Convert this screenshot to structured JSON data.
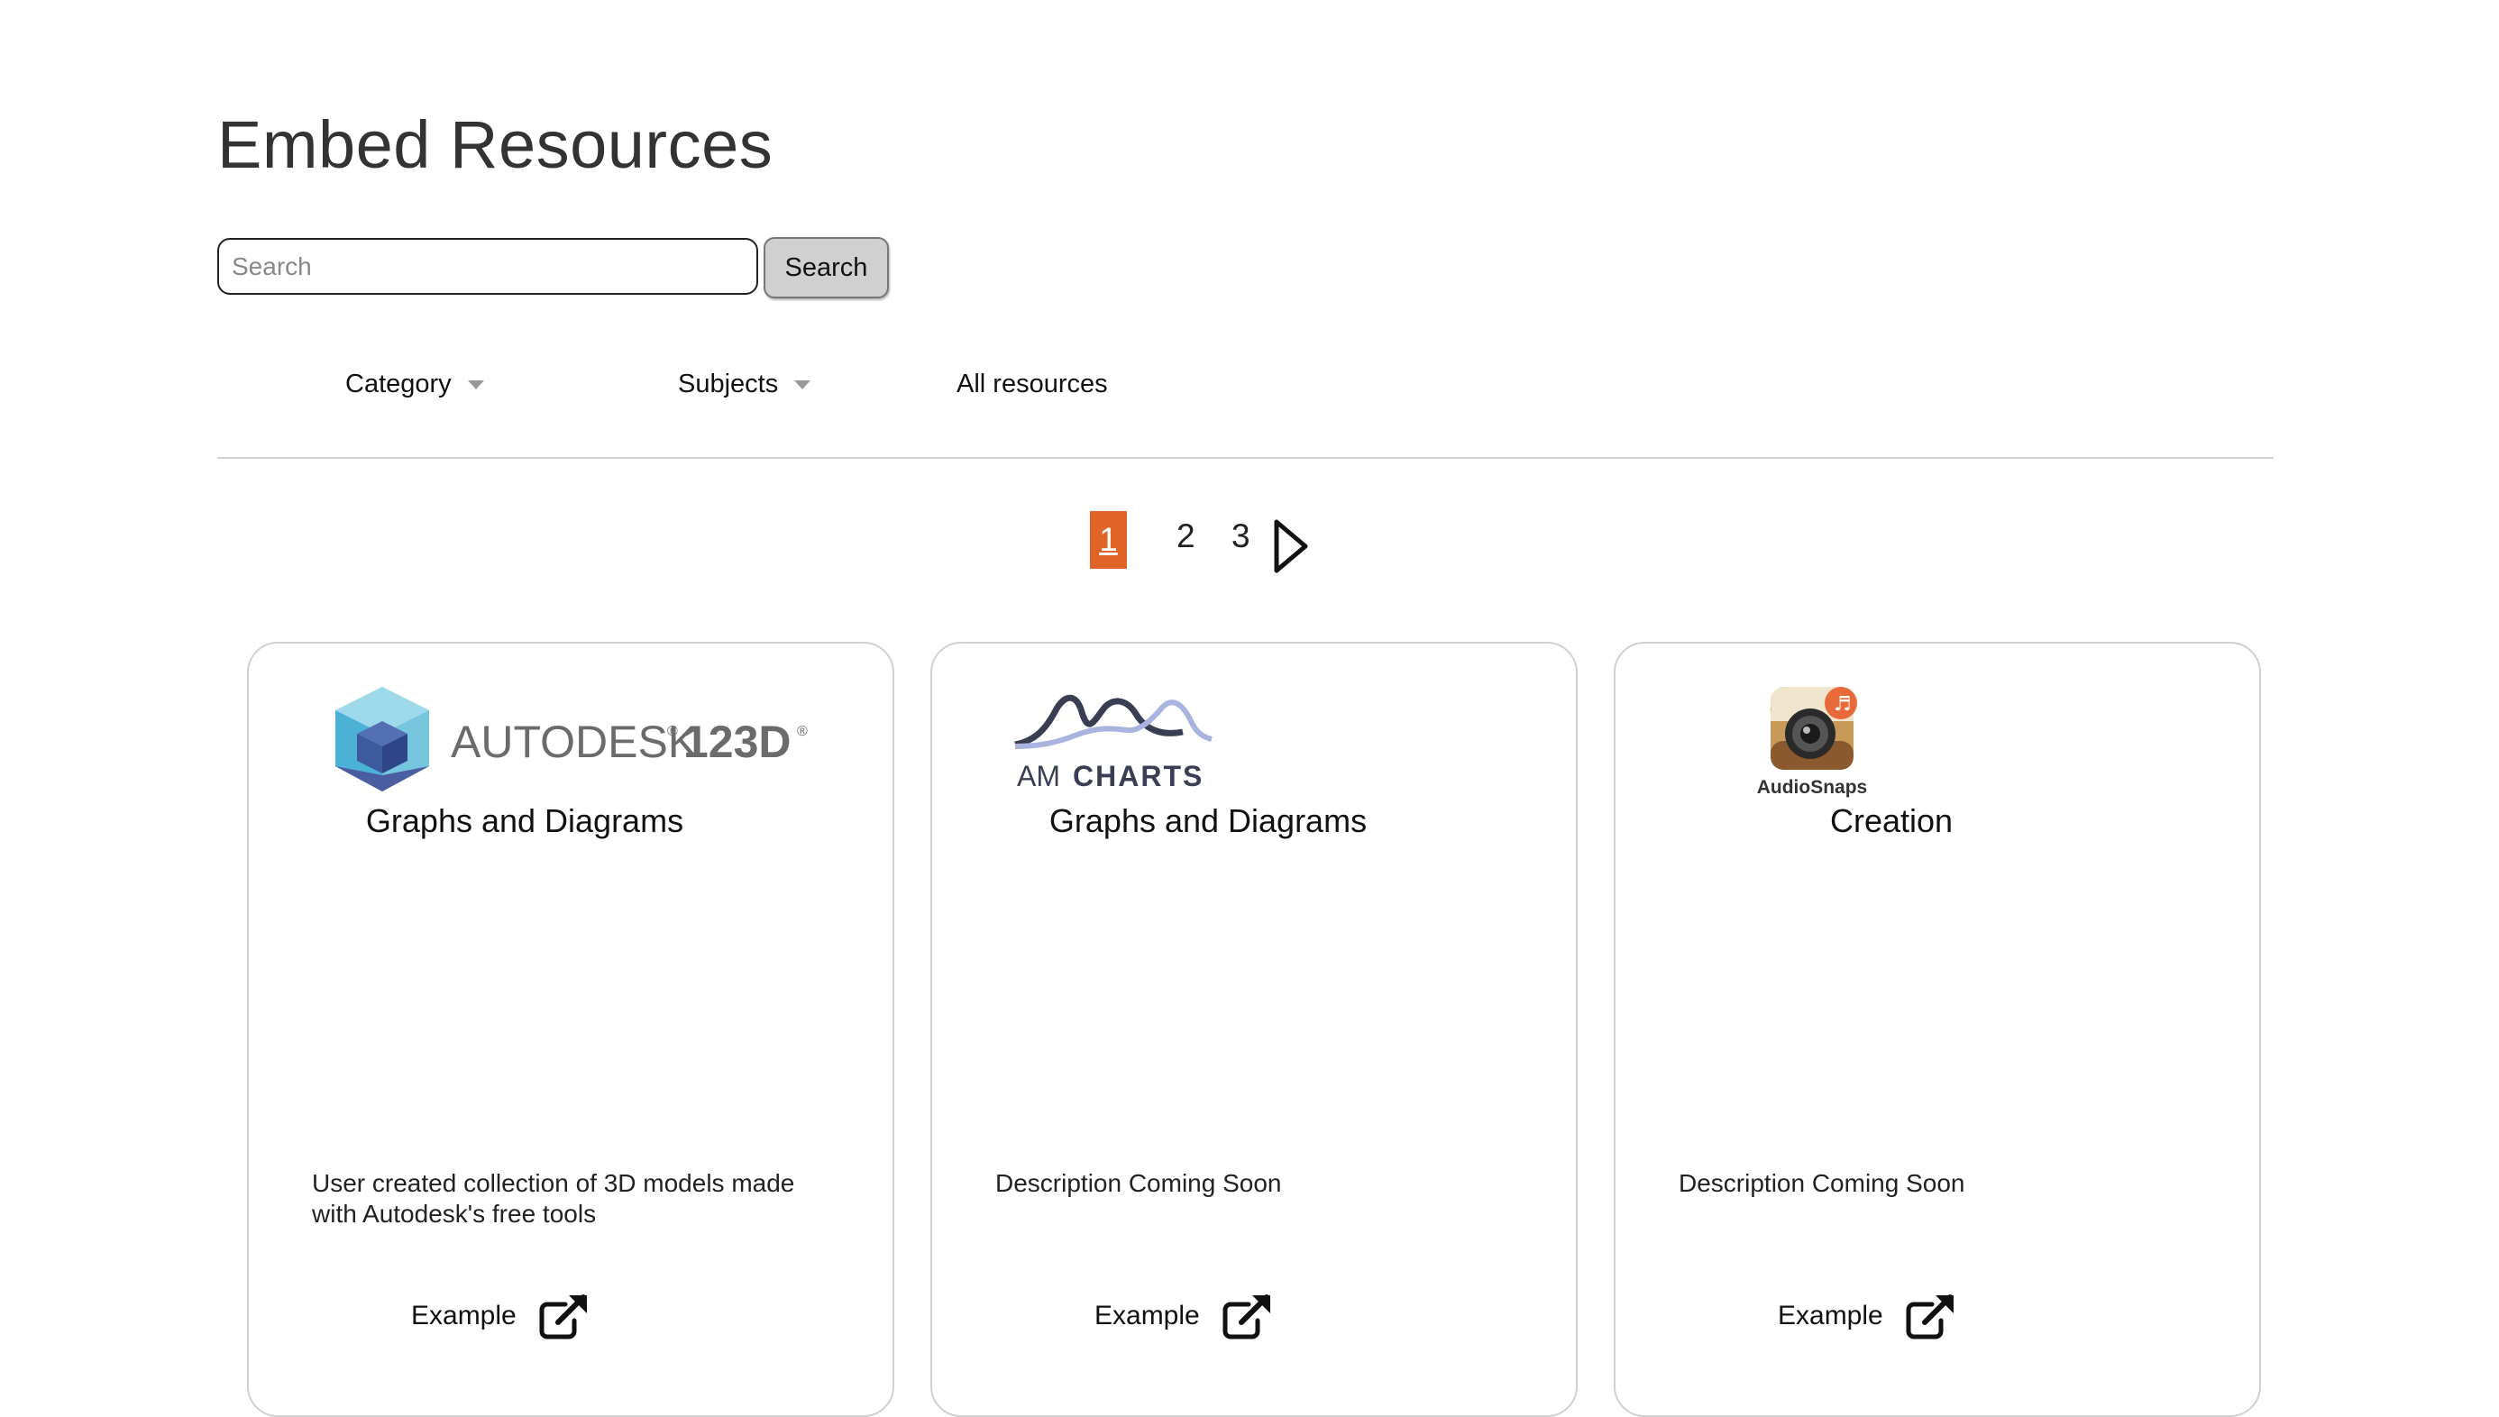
{
  "page": {
    "title": "Embed Resources"
  },
  "search": {
    "placeholder": "Search",
    "button_label": "Search"
  },
  "filters": {
    "category_label": "Category",
    "subjects_label": "Subjects",
    "all_resources_label": "All resources"
  },
  "pagination": {
    "current": "1",
    "pages": [
      "2",
      "3"
    ]
  },
  "colors": {
    "accent": "#e06427"
  },
  "cards": [
    {
      "logo_icon": "autodesk-123d-logo",
      "logo_text": "AUTODESK 123D",
      "category": "Graphs and Diagrams",
      "description": "User created collection of 3D models made with Autodesk's free tools",
      "example_label": "Example"
    },
    {
      "logo_icon": "amcharts-logo",
      "logo_text": "AMCHARTS",
      "category": "Graphs and Diagrams",
      "description": "Description Coming Soon",
      "example_label": "Example"
    },
    {
      "logo_icon": "audiosnaps-logo",
      "logo_text": "AudioSnaps",
      "category": "Creation",
      "description": "Description Coming Soon",
      "example_label": "Example"
    }
  ]
}
